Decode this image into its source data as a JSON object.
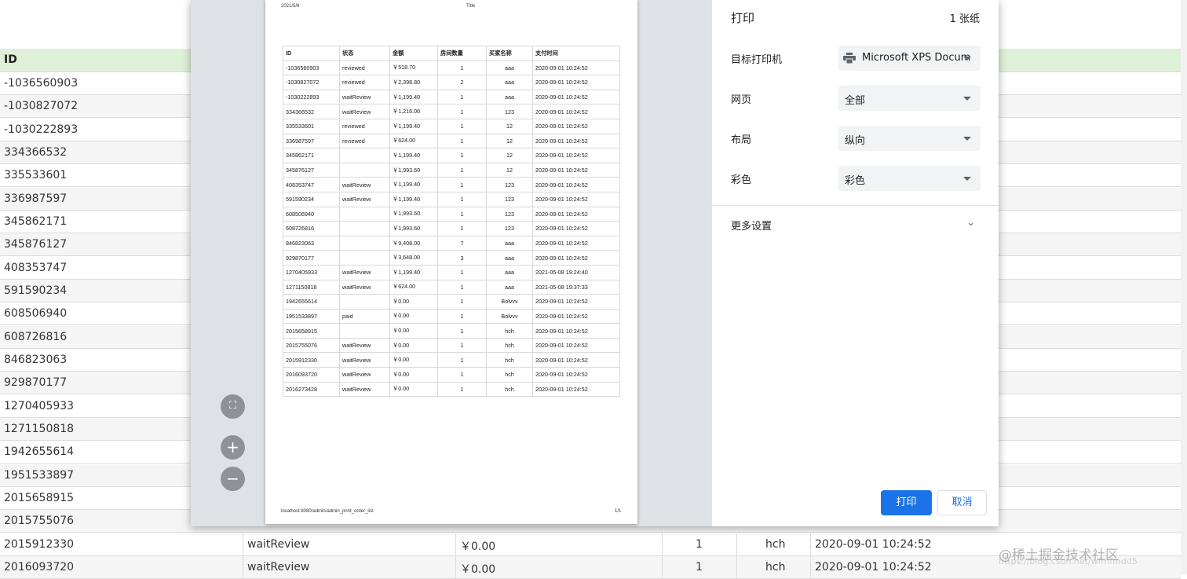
{
  "background": {
    "header": "ID",
    "ids": [
      "-1036560903",
      "-1030827072",
      "-1030222893",
      "334366532",
      "335533601",
      "336987597",
      "345862171",
      "345876127",
      "408353747",
      "591590234",
      "608506940",
      "608726816",
      "846823063",
      "929870177",
      "1270405933",
      "1271150818",
      "1942655614",
      "1951533897",
      "2015658915",
      "2015755076",
      "2015912330",
      "2016093720"
    ],
    "full_rows": [
      {
        "id": "2015912330",
        "status": "waitReview",
        "amount": "￥0.00",
        "rooms": "1",
        "buyer": "hch",
        "time": "2020-09-01 10:24:52"
      },
      {
        "id": "2016093720",
        "status": "waitReview",
        "amount": "￥0.00",
        "rooms": "1",
        "buyer": "hch",
        "time": "2020-09-01 10:24:52"
      }
    ]
  },
  "preview": {
    "date": "2021/5/8",
    "title": "Title",
    "url": "localhost:8080/admin/admin_print_order_list",
    "page": "1/1",
    "columns": [
      "ID",
      "状态",
      "金额",
      "房间数量",
      "买家名称",
      "支付时间"
    ],
    "rows": [
      [
        "-1036560903",
        "reviewed",
        "￥518.70",
        "1",
        "aaa",
        "2020-09-01 10:24:52"
      ],
      [
        "-1030827072",
        "reviewed",
        "￥2,398.80",
        "2",
        "aaa",
        "2020-09-01 10:24:52"
      ],
      [
        "-1030222893",
        "waitReview",
        "￥1,199.40",
        "1",
        "aaa",
        "2020-09-01 10:24:52"
      ],
      [
        "334366532",
        "waitReview",
        "￥1,216.00",
        "1",
        "123",
        "2020-09-01 10:24:52"
      ],
      [
        "335533601",
        "reviewed",
        "￥1,199.40",
        "1",
        "12",
        "2020-09-01 10:24:52"
      ],
      [
        "336987597",
        "reviewed",
        "￥624.00",
        "1",
        "12",
        "2020-09-01 10:24:52"
      ],
      [
        "345862171",
        "",
        "￥1,199.40",
        "1",
        "12",
        "2020-09-01 10:24:52"
      ],
      [
        "345876127",
        "",
        "￥1,993.60",
        "1",
        "12",
        "2020-09-01 10:24:52"
      ],
      [
        "408353747",
        "waitReview",
        "￥1,199.40",
        "1",
        "123",
        "2020-09-01 10:24:52"
      ],
      [
        "591590234",
        "waitReview",
        "￥1,199.40",
        "1",
        "123",
        "2020-09-01 10:24:52"
      ],
      [
        "608506940",
        "",
        "￥1,993.60",
        "1",
        "123",
        "2020-09-01 10:24:52"
      ],
      [
        "608726816",
        "",
        "￥1,993.60",
        "1",
        "123",
        "2020-09-01 10:24:52"
      ],
      [
        "846823063",
        "",
        "￥9,408.00",
        "7",
        "aaa",
        "2020-09-01 10:24:52"
      ],
      [
        "929870177",
        "",
        "￥3,648.00",
        "3",
        "aaa",
        "2020-09-01 10:24:52"
      ],
      [
        "1270405933",
        "waitReview",
        "￥1,199.40",
        "1",
        "aaa",
        "2021-05-08 19:24:40"
      ],
      [
        "1271150818",
        "waitReview",
        "￥624.00",
        "1",
        "aaa",
        "2021-05-08 19:37:33"
      ],
      [
        "1942655614",
        "",
        "￥0.00",
        "1",
        "Bolvvv",
        "2020-09-01 10:24:52"
      ],
      [
        "1951533897",
        "paid",
        "￥0.00",
        "1",
        "Bolvvv",
        "2020-09-01 10:24:52"
      ],
      [
        "2015658915",
        "",
        "￥0.00",
        "1",
        "hch",
        "2020-09-01 10:24:52"
      ],
      [
        "2015755076",
        "waitReview",
        "￥0.00",
        "1",
        "hch",
        "2020-09-01 10:24:52"
      ],
      [
        "2015912330",
        "waitReview",
        "￥0.00",
        "1",
        "hch",
        "2020-09-01 10:24:52"
      ],
      [
        "2016093720",
        "waitReview",
        "￥0.00",
        "1",
        "hch",
        "2020-09-01 10:24:52"
      ],
      [
        "2016273428",
        "waitReview",
        "￥0.00",
        "1",
        "hch",
        "2020-09-01 10:24:52"
      ]
    ]
  },
  "settings": {
    "title": "打印",
    "sheets": "1 张纸",
    "destination_label": "目标打印机",
    "destination_value": "Microsoft XPS Docum",
    "pages_label": "网页",
    "pages_value": "全部",
    "layout_label": "布局",
    "layout_value": "纵向",
    "color_label": "彩色",
    "color_value": "彩色",
    "more_label": "更多设置",
    "print_label": "打印",
    "cancel_label": "取消"
  },
  "zoom": {
    "fit": "⛶",
    "zoom_in": "+",
    "zoom_out": "−"
  },
  "watermark": {
    "text": "@稀土掘金技术社区",
    "url": "https://blog.csdn.net/wfmfmdd5"
  },
  "colors": {
    "header_bg": "#dff0d8",
    "print_button": "#1a73e8",
    "dialog_bg": "#dee1e6"
  }
}
